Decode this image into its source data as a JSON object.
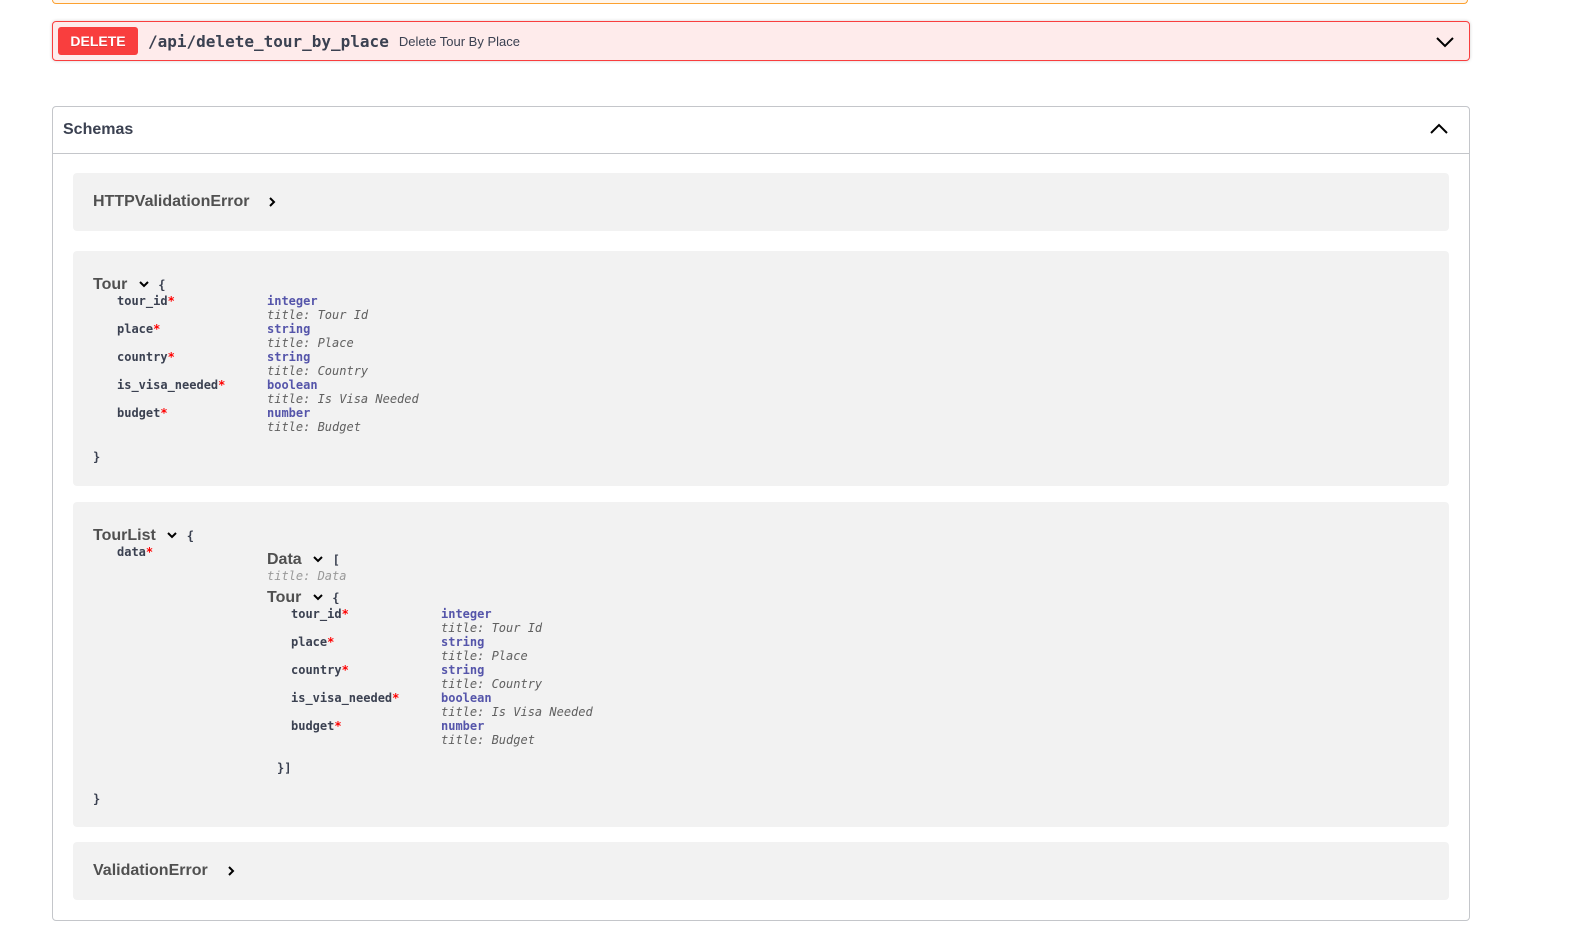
{
  "delete_op": {
    "method": "DELETE",
    "path": "/api/delete_tour_by_place",
    "summary": "Delete Tour By Place"
  },
  "schemas": {
    "title": "Schemas",
    "http_validation_error": {
      "name": "HTTPValidationError"
    },
    "tour": {
      "name": "Tour",
      "open": "{",
      "close": "}",
      "properties": [
        {
          "name": "tour_id",
          "type": "integer",
          "title": "title: Tour Id"
        },
        {
          "name": "place",
          "type": "string",
          "title": "title: Place"
        },
        {
          "name": "country",
          "type": "string",
          "title": "title: Country"
        },
        {
          "name": "is_visa_needed",
          "type": "boolean",
          "title": "title: Is Visa Needed"
        },
        {
          "name": "budget",
          "type": "number",
          "title": "title: Budget"
        }
      ]
    },
    "tour_list": {
      "name": "TourList",
      "open": "{",
      "close": "}",
      "data_prop": "data",
      "data_array": {
        "name": "Data",
        "open": "[",
        "title": "title: Data",
        "close": "}]"
      },
      "inner_tour": {
        "name": "Tour",
        "open": "{",
        "properties": [
          {
            "name": "tour_id",
            "type": "integer",
            "title": "title: Tour Id"
          },
          {
            "name": "place",
            "type": "string",
            "title": "title: Place"
          },
          {
            "name": "country",
            "type": "string",
            "title": "title: Country"
          },
          {
            "name": "is_visa_needed",
            "type": "boolean",
            "title": "title: Is Visa Needed"
          },
          {
            "name": "budget",
            "type": "number",
            "title": "title: Budget"
          }
        ]
      }
    },
    "validation_error": {
      "name": "ValidationError"
    },
    "required_marker": "*"
  }
}
